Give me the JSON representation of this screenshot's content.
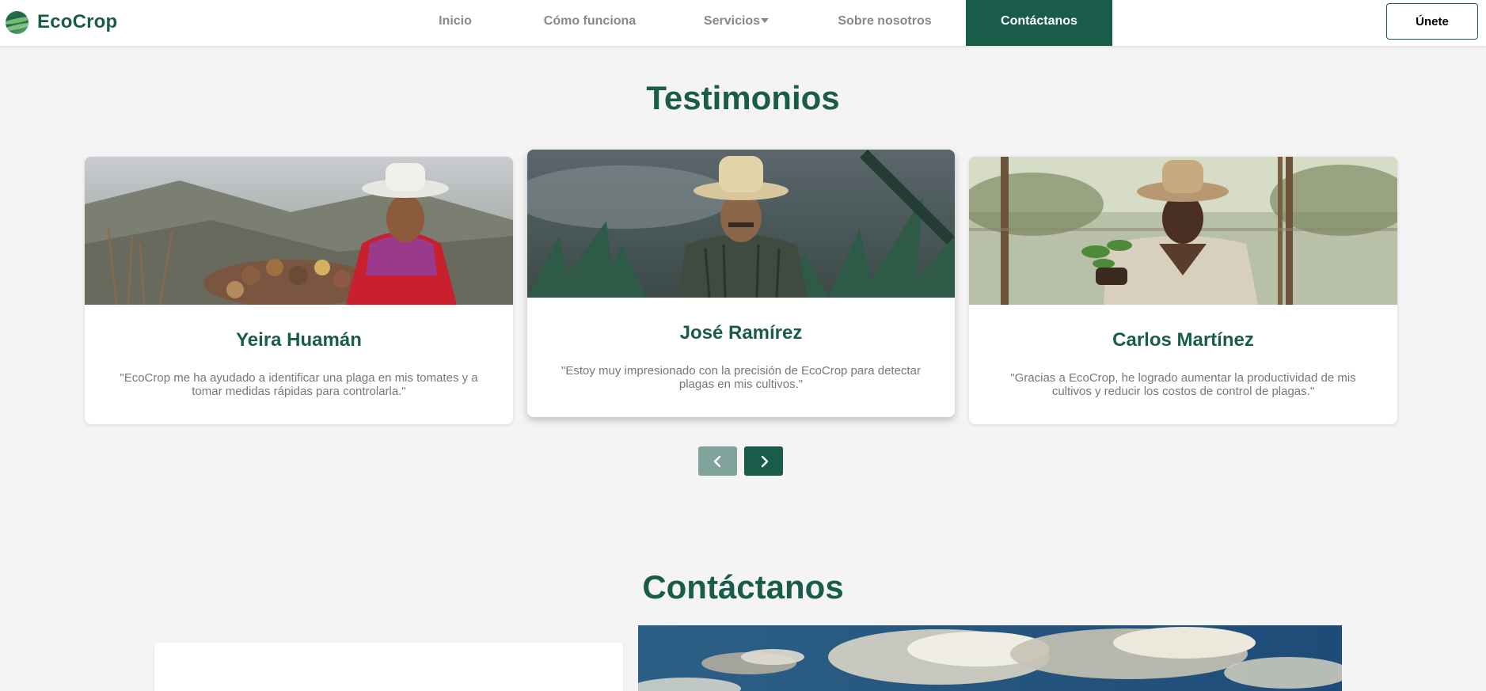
{
  "brand": {
    "name": "EcoCrop",
    "logo_icon": "globe-leaf-icon"
  },
  "nav": {
    "items": [
      {
        "label": "Inicio"
      },
      {
        "label": "Cómo funciona"
      },
      {
        "label": "Servicios"
      },
      {
        "label": "Sobre nosotros"
      },
      {
        "label": "Contáctanos",
        "active": true
      }
    ],
    "join_label": "Únete"
  },
  "testimonials": {
    "title": "Testimonios",
    "cards": [
      {
        "name": "Yeira Huamán",
        "quote": "\"EcoCrop me ha ayudado a identificar una plaga en mis tomates y a tomar medidas rápidas para controlarla.\""
      },
      {
        "name": "José Ramírez",
        "quote": "\"Estoy muy impresionado con la precisión de EcoCrop para detectar plagas en mis cultivos.\""
      },
      {
        "name": "Carlos Martínez",
        "quote": "\"Gracias a EcoCrop, he logrado aumentar la productividad de mis cultivos y reducir los costos de control de plagas.\""
      }
    ],
    "prev_icon": "chevron-left-icon",
    "next_icon": "chevron-right-icon"
  },
  "contact": {
    "title": "Contáctanos"
  },
  "colors": {
    "brand": "#1a5c4a",
    "prev_button": "#7fa39b",
    "background": "#f4f4f4"
  }
}
